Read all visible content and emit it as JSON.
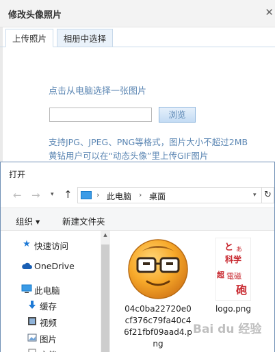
{
  "upload_dialog": {
    "title": "修改头像照片",
    "close": "✕",
    "tabs": [
      {
        "label": "上传照片",
        "active": true
      },
      {
        "label": "相册中选择",
        "active": false
      }
    ],
    "heading": "点击从电脑选择一张图片",
    "file_input_value": "",
    "browse_label": "浏览",
    "hint_line_1": "支持JPG、JPEG、PNG等格式，图片大小不超过2MB",
    "hint_line_2": "黄钻用户可以在“动态头像”里上传GIF图片"
  },
  "open_dialog": {
    "title": "打开",
    "nav": {
      "back": "←",
      "forward": "→",
      "dropdown": "▾",
      "up": "↑",
      "refresh": "↻"
    },
    "breadcrumb": [
      "此电脑",
      "桌面"
    ],
    "breadcrumb_sep": "›",
    "address_dropdown": "▾",
    "command_bar": {
      "organize": "组织 ▾",
      "new_folder": "新建文件夹"
    },
    "nav_items": [
      {
        "label": "快速访问",
        "icon": "star-icon"
      },
      {
        "label": "OneDrive",
        "icon": "cloud-icon"
      },
      {
        "label": "此电脑",
        "icon": "computer-icon"
      },
      {
        "label": "缓存",
        "icon": "download-arrow-icon"
      },
      {
        "label": "视频",
        "icon": "video-icon"
      },
      {
        "label": "图片",
        "icon": "picture-icon"
      },
      {
        "label": "文档",
        "icon": "document-icon"
      }
    ],
    "files": [
      {
        "name": "04c0ba22720e0cf376c79fa40c46f21fbf09aad4.png"
      },
      {
        "name": "logo.png",
        "logo_text": "とある科学の超電磁砲"
      }
    ]
  },
  "watermark": "Bai du 经验",
  "colors": {
    "accent": "#5b86b3",
    "pc_blue": "#1579c9",
    "logo_red": "#c8282f"
  }
}
